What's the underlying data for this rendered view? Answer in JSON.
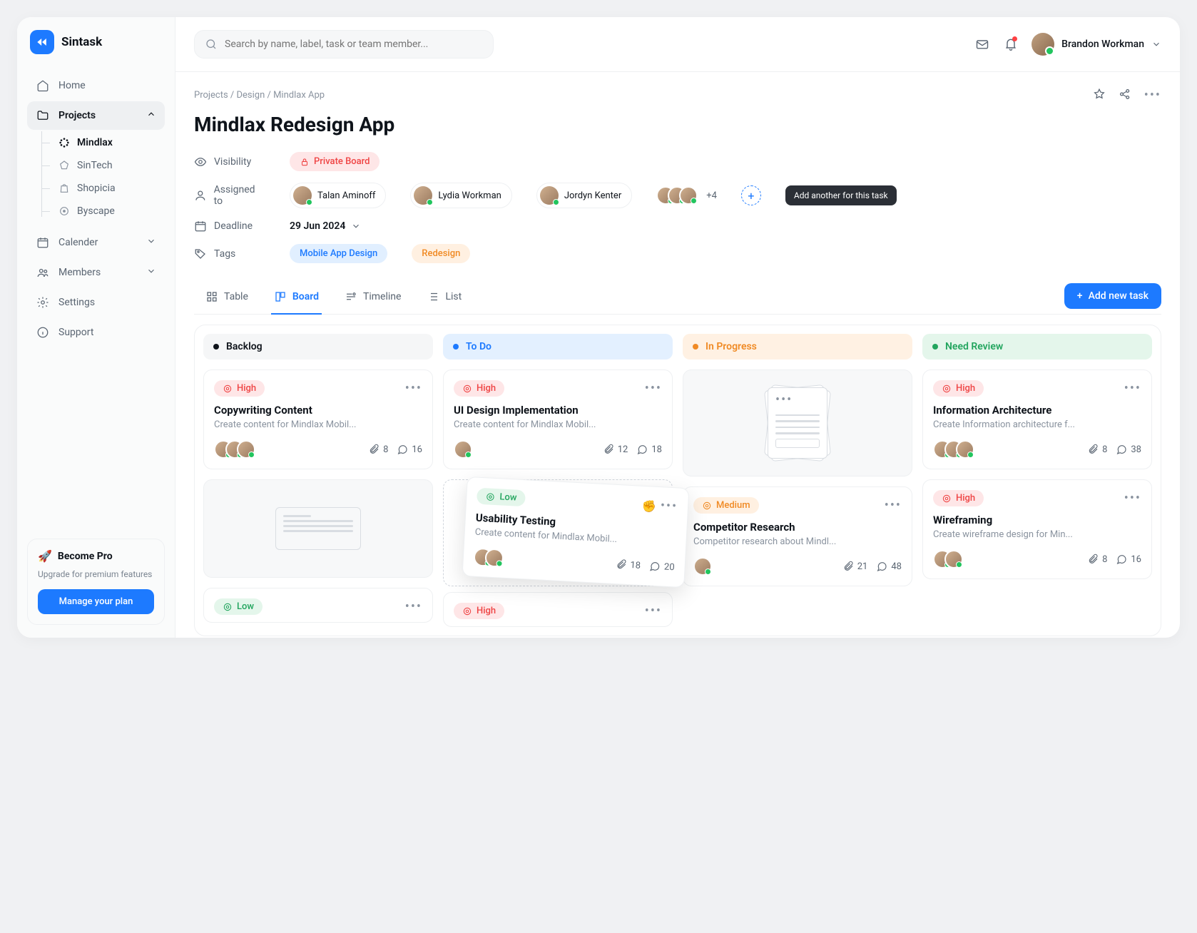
{
  "brand": "Sintask",
  "search": {
    "placeholder": "Search by name, label, task or team member..."
  },
  "user": {
    "name": "Brandon Workman"
  },
  "nav": {
    "home": "Home",
    "projects": "Projects",
    "calendar": "Calender",
    "members": "Members",
    "settings": "Settings",
    "support": "Support",
    "sub": [
      "Mindlax",
      "SinTech",
      "Shopicia",
      "Byscape"
    ]
  },
  "pro": {
    "title": "Become Pro",
    "subtitle": "Upgrade for premium features",
    "button": "Manage your plan"
  },
  "breadcrumb": "Projects / Design / Mindlax App",
  "page_title": "Mindlax Redesign App",
  "meta": {
    "visibility_label": "Visibility",
    "visibility_value": "Private Board",
    "assigned_label": "Assigned to",
    "assignees": [
      "Talan Aminoff",
      "Lydia Workman",
      "Jordyn Kenter"
    ],
    "overflow_count": "+4",
    "add_tooltip": "Add another for this task",
    "deadline_label": "Deadline",
    "deadline_value": "29 Jun 2024",
    "tags_label": "Tags",
    "tags": [
      "Mobile App Design",
      "Redesign"
    ]
  },
  "tabs": {
    "table": "Table",
    "board": "Board",
    "timeline": "Timeline",
    "list": "List"
  },
  "add_task": "Add new task",
  "columns": {
    "backlog": "Backlog",
    "todo": "To Do",
    "progress": "In Progress",
    "review": "Need Review"
  },
  "cards": {
    "copywriting": {
      "priority": "High",
      "title": "Copywriting Content",
      "desc": "Create content for Mindlax Mobil...",
      "attach": "8",
      "comments": "16"
    },
    "uidesign": {
      "priority": "High",
      "title": "UI Design Implementation",
      "desc": "Create content for Mindlax Mobil...",
      "attach": "12",
      "comments": "18"
    },
    "usability": {
      "priority": "Low",
      "title": "Usability Testing",
      "desc": "Create content for Mindlax Mobil...",
      "attach": "18",
      "comments": "20"
    },
    "competitor": {
      "priority": "Medium",
      "title": "Competitor Research",
      "desc": "Competitor research about Mindl...",
      "attach": "21",
      "comments": "48"
    },
    "ia": {
      "priority": "High",
      "title": "Information Architecture",
      "desc": "Create Information architecture f...",
      "attach": "8",
      "comments": "38"
    },
    "wireframe": {
      "priority": "High",
      "title": "Wireframing",
      "desc": "Create wireframe design for Min...",
      "attach": "8",
      "comments": "16"
    },
    "backlog_low": {
      "priority": "Low"
    },
    "todo_high": {
      "priority": "High"
    }
  }
}
